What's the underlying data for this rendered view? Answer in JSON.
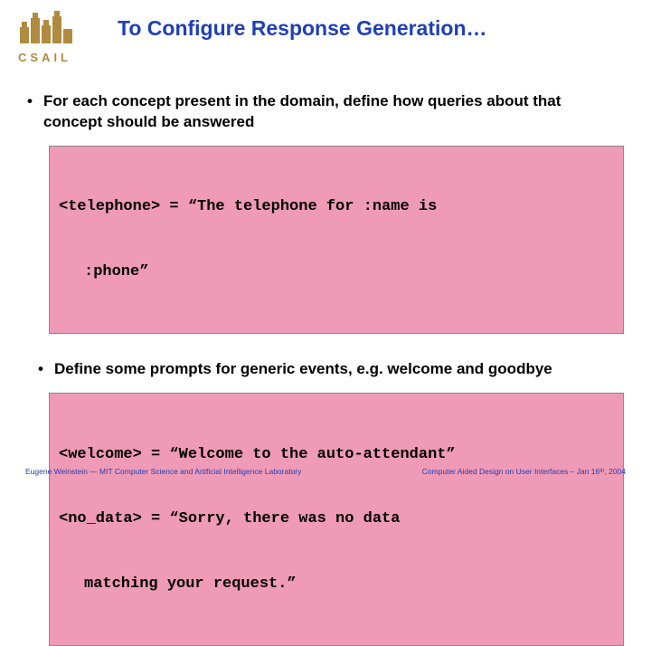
{
  "logo": {
    "text": "CSAIL"
  },
  "title": "To Configure Response Generation…",
  "bullets": [
    "For each concept present in the domain, define how queries about that concept should be answered",
    "Define some prompts for generic events, e.g. welcome and goodbye"
  ],
  "code1": {
    "line1": "<telephone> = “The telephone for :name is",
    "line2": ":phone”"
  },
  "code2": {
    "line1": "<welcome> = “Welcome to the auto-attendant”",
    "line2": "<no_data> = “Sorry, there was no data",
    "line3": "matching your request.”"
  },
  "footer": {
    "left": "Eugene Weinstein — MIT Computer Science and Artificial Intelligence Laboratory",
    "right": "Computer Aided Design on User Interfaces – Jan 16ᵗʰ, 2004"
  }
}
